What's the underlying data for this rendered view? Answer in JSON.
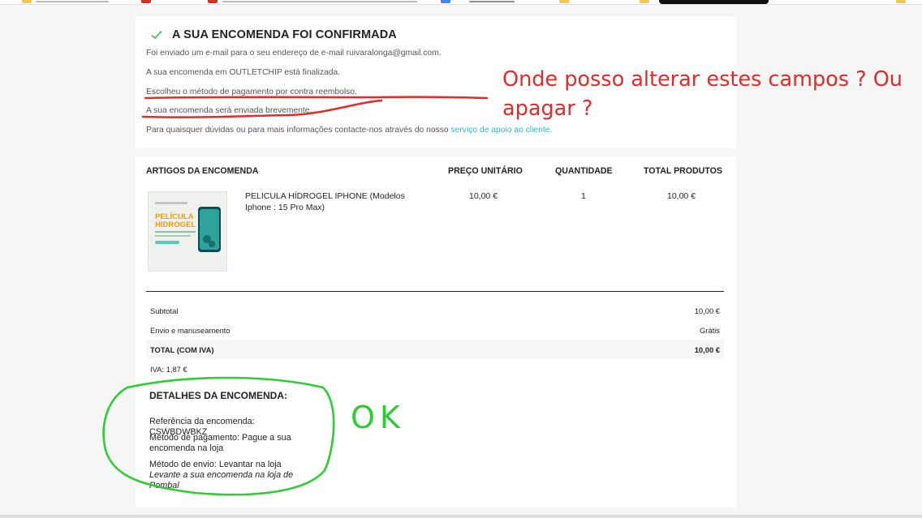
{
  "confirmation": {
    "title": "A SUA ENCOMENDA FOI CONFIRMADA",
    "lines": [
      "Foi enviado um e-mail para o seu endereço de e-mail ruivaralonga@gmail.com.",
      "A sua encomenda em OUTLETCHIP está finalizada.",
      "Escolheu o método de pagamento por contra reembolso.",
      "A sua encomenda será enviada brevemente."
    ],
    "contact_text": "Para quaisquer dúvidas ou para mais informações contacte-nos através do nosso",
    "contact_link": "serviço de apoio ao cliente."
  },
  "order": {
    "headers": {
      "items": "ARTIGOS DA ENCOMENDA",
      "unit_price": "PREÇO UNITÁRIO",
      "quantity": "QUANTIDADE",
      "total": "TOTAL PRODUTOS"
    },
    "product": {
      "name": "PELICULA HÍDROGEL IPHONE (Modelos Iphone : 15 Pro Max)",
      "unit_price": "10,00 €",
      "quantity": "1",
      "total": "10,00 €",
      "image_title_1": "PELÍCULA",
      "image_title_2": "HIDROGEL"
    },
    "summary": {
      "subtotal_label": "Subtotal",
      "subtotal_value": "10,00 €",
      "shipping_label": "Envio e manuseamento",
      "shipping_value": "Grátis",
      "total_label": "TOTAL (COM IVA)",
      "total_value": "10,00 €",
      "iva": "IVA: 1,87 €"
    }
  },
  "details": {
    "title": "DETALHES DA ENCOMENDA:",
    "reference": "Referência da encomenda: CSWBDWBKZ",
    "payment": "Método de pagamento: Pague a sua encomenda na loja",
    "shipping": "Método de envio: Levantar na loja",
    "shipping_note": "Levante a sua encomenda na loja de Pombal"
  },
  "annotations": {
    "question": "Onde posso alterar estes campos ? Ou apagar ?",
    "ok": "OK",
    "red_color": "#e52a2a",
    "green_color": "#2ecc35"
  },
  "colors": {
    "accent_link": "#2fb5d2",
    "check": "#4cbb6c"
  }
}
